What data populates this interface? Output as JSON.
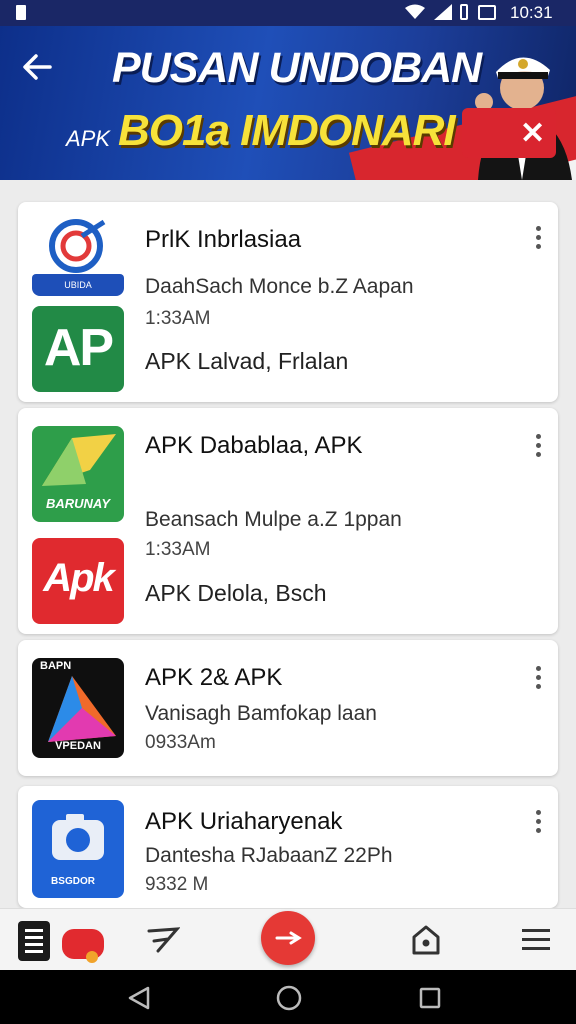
{
  "status_bar": {
    "time": "10:31"
  },
  "banner": {
    "title": "PUSAN UNDOBAN",
    "subtitle_prefix": "APK",
    "subtitle": "BO1a IMDONARI"
  },
  "cards": [
    {
      "items": [
        {
          "icon": "blue-circle-logo-icon",
          "icon_caption": "UBIDA",
          "title": "PrlK Inbrlasiaa",
          "subtitle": "DaahSach Monce b.Z Aapan",
          "time": "1:33AM"
        },
        {
          "icon": "ap-logo-icon",
          "icon_text": "AP",
          "subtitle": "APK Lalvad, Frlalan"
        }
      ]
    },
    {
      "items": [
        {
          "icon": "green-envelope-icon",
          "icon_caption": "BARUNAY",
          "title": "APK Dabablaa, APK",
          "subtitle": "Beansach Mulpe a.Z 1ppan",
          "time": "1:33AM"
        },
        {
          "icon": "apk-red-logo-icon",
          "icon_text": "Apk",
          "subtitle": "APK Delola, Bsch"
        }
      ]
    },
    {
      "items": [
        {
          "icon": "play-store-icon",
          "icon_caption_top": "BAPN",
          "icon_caption": "VPEDAN",
          "title": "APK 2& APK",
          "subtitle": "Vanisagh Bamfokap laan",
          "time": "0933Am"
        }
      ]
    },
    {
      "items": [
        {
          "icon": "camera-app-icon",
          "icon_caption": "BSGDOR",
          "title": "APK Uriaharyenak",
          "subtitle": "Dantesha RJabaanZ 22Ph",
          "time": "9332 M"
        }
      ]
    }
  ],
  "colors": {
    "accent": "#e53935",
    "banner": "#1f4fb8",
    "highlight": "#f7e23a"
  }
}
